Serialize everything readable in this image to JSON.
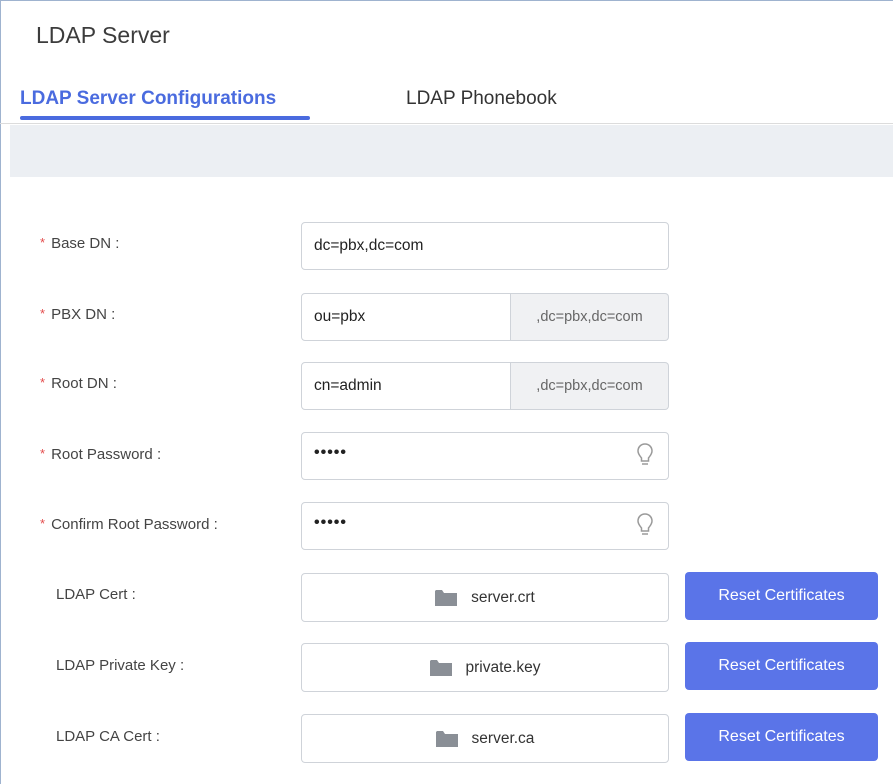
{
  "page": {
    "title": "LDAP Server"
  },
  "tabs": [
    {
      "label": "LDAP Server Configurations",
      "active": true
    },
    {
      "label": "LDAP Phonebook",
      "active": false
    }
  ],
  "form": {
    "required_mark": "*",
    "base_dn": {
      "label": "Base DN :",
      "value": "dc=pbx,dc=com"
    },
    "pbx_dn": {
      "label": "PBX DN :",
      "value": "ou=pbx",
      "suffix": ",dc=pbx,dc=com"
    },
    "root_dn": {
      "label": "Root DN :",
      "value": "cn=admin",
      "suffix": ",dc=pbx,dc=com"
    },
    "root_password": {
      "label": "Root Password :",
      "value": "•••••"
    },
    "confirm_root_password": {
      "label": "Confirm Root Password :",
      "value": "•••••"
    },
    "ldap_cert": {
      "label": "LDAP Cert :",
      "file": "server.crt",
      "button": "Reset Certificates"
    },
    "ldap_private_key": {
      "label": "LDAP Private Key :",
      "file": "private.key",
      "button": "Reset Certificates"
    },
    "ldap_ca_cert": {
      "label": "LDAP CA Cert :",
      "file": "server.ca",
      "button": "Reset Certificates"
    }
  },
  "icons": {
    "password_toggle": "lightbulb-icon",
    "file": "folder-icon"
  },
  "colors": {
    "accent": "#4a6bdf",
    "button": "#5a74e8",
    "required": "#e34b4b"
  }
}
